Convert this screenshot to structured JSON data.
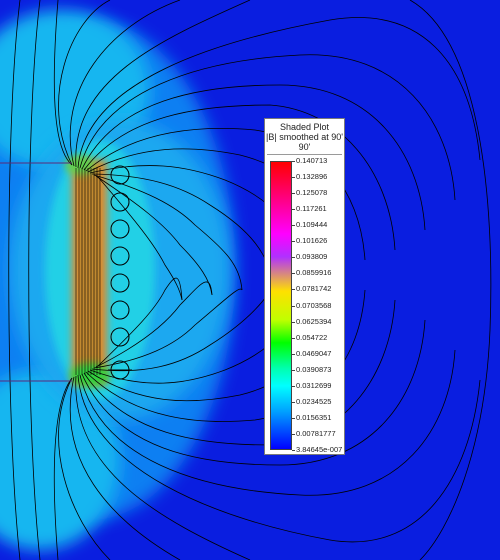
{
  "legend": {
    "title_line1": "Shaded Plot",
    "title_line2": "|B| smoothed at 90'",
    "title_line3": "90'",
    "values": [
      "0.140713",
      "0.132896",
      "0.125078",
      "0.117261",
      "0.109444",
      "0.101626",
      "0.093809",
      "0.0859916",
      "0.0781742",
      "0.0703568",
      "0.0625394",
      "0.054722",
      "0.0469047",
      "0.0390873",
      "0.0312699",
      "0.0234525",
      "0.0156351",
      "0.00781777",
      "3.84645e-007"
    ],
    "colors": [
      "#ff0000",
      "#ff00ff",
      "#ffe000",
      "#00ff00",
      "#00ffff",
      "#00a0ff",
      "#0000ff"
    ]
  }
}
